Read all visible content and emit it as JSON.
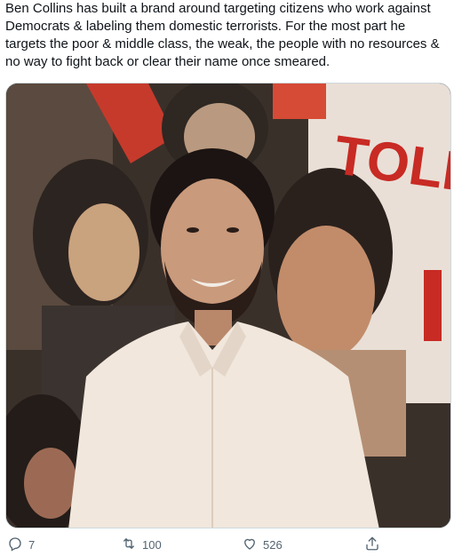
{
  "tweet": {
    "text": "Ben Collins has built a brand around targeting citizens who work against Democrats & labeling them domestic terrorists. For the most part he targets the poor & middle class, the weak, the people with no resources & no way to fight back or clear their name once smeared."
  },
  "media": {
    "mural_text": "TOLE"
  },
  "actions": {
    "reply_count": "7",
    "retweet_count": "100",
    "like_count": "526"
  },
  "icons": [
    "reply-icon",
    "retweet-icon",
    "like-icon",
    "share-icon"
  ]
}
